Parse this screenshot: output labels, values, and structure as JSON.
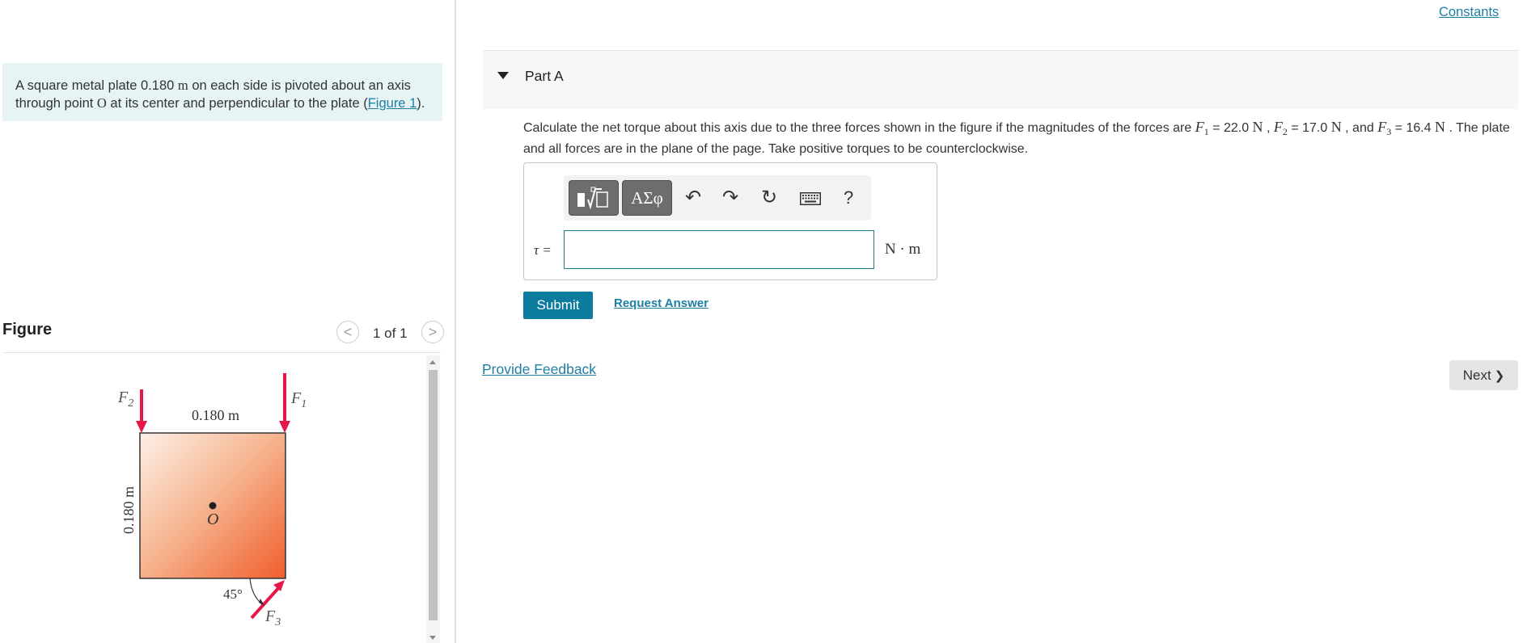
{
  "intro": {
    "text_before": "A square metal plate 0.180 ",
    "unit_m": "m",
    "text_mid": " on each side is pivoted about an axis through point ",
    "point": "O",
    "text_after": " at its center and perpendicular to the plate (",
    "figure_link": "Figure 1",
    "text_end": ")."
  },
  "figure": {
    "title": "Figure",
    "pager": "1 of 1",
    "prev_glyph": "<",
    "next_glyph": ">",
    "labels": {
      "F1": "F",
      "F1_sub": "1",
      "F2": "F",
      "F2_sub": "2",
      "F3": "F",
      "F3_sub": "3",
      "top_dim": "0.180 m",
      "side_dim": "0.180 m",
      "center": "O",
      "angle": "45°"
    },
    "colors": {
      "arrow": "#e8174a",
      "plate_light": "#fbe9df",
      "plate_dark": "#f06533"
    }
  },
  "constants_link": "Constants",
  "part": {
    "label": "Part A"
  },
  "question": {
    "t1": "Calculate the net torque about this axis due to the three forces shown in the figure if the magnitudes of the forces are ",
    "f1": "F",
    "f1_sub": "1",
    "v1": " = 22.0 ",
    "u1": "N",
    "c1": " , ",
    "f2": "F",
    "f2_sub": "2",
    "v2": " = 17.0 ",
    "u2": "N",
    "c2": " , and ",
    "f3": "F",
    "f3_sub": "3",
    "v3": " = 16.4 ",
    "u3": "N",
    "t2": " . The plate and all forces are in the plane of the page. Take positive torques to be counterclockwise."
  },
  "toolbar": {
    "templates_icon": "templates-icon",
    "greek_label": "ΑΣφ",
    "undo_glyph": "↶",
    "redo_glyph": "↷",
    "reset_glyph": "↻",
    "keyboard_icon": "keyboard-icon",
    "help_label": "?"
  },
  "answer": {
    "label": "τ =",
    "value": "",
    "unit": "N · m"
  },
  "buttons": {
    "submit": "Submit",
    "request_answer": "Request Answer",
    "provide_feedback": "Provide Feedback",
    "next": "Next",
    "next_glyph": "❯"
  }
}
